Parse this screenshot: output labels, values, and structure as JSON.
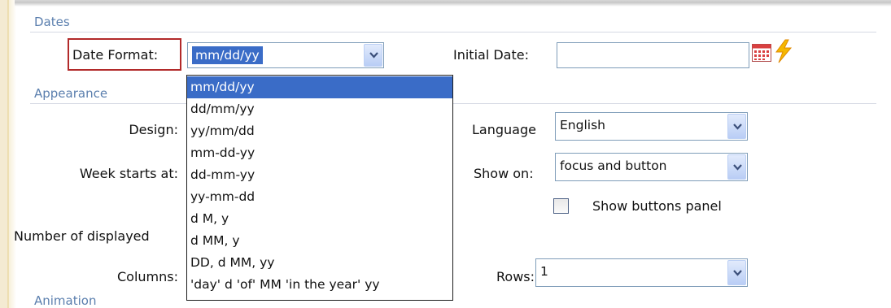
{
  "sections": {
    "dates": "Dates",
    "appearance": "Appearance",
    "animation": "Animation"
  },
  "date_format": {
    "label": "Date Format:",
    "selected": "mm/dd/yy",
    "options": [
      "mm/dd/yy",
      "dd/mm/yy",
      "yy/mm/dd",
      "mm-dd-yy",
      "dd-mm-yy",
      "yy-mm-dd",
      "d M, y",
      "d MM, y",
      "DD, d MM, yy",
      "'day' d 'of' MM 'in the year' yy"
    ]
  },
  "initial_date": {
    "label": "Initial Date:",
    "value": ""
  },
  "appearance": {
    "design_label": "Design:",
    "week_starts_label": "Week starts at:",
    "months_label": "Number of displayed",
    "columns_label": "Columns:",
    "language_label": "Language",
    "language_value": "English",
    "show_on_label": "Show on:",
    "show_on_value": "focus and button",
    "show_buttons_label": "Show buttons panel",
    "show_buttons_checked": false,
    "rows_label": "Rows:",
    "rows_value": "1"
  },
  "colors": {
    "accent": "#3a6cc7",
    "section_title": "#5b7fae",
    "highlight": "#b22a2a",
    "lightning": "#f5b800"
  },
  "icons": [
    "calendar-icon",
    "lightning-icon",
    "chevron-down-icon"
  ]
}
